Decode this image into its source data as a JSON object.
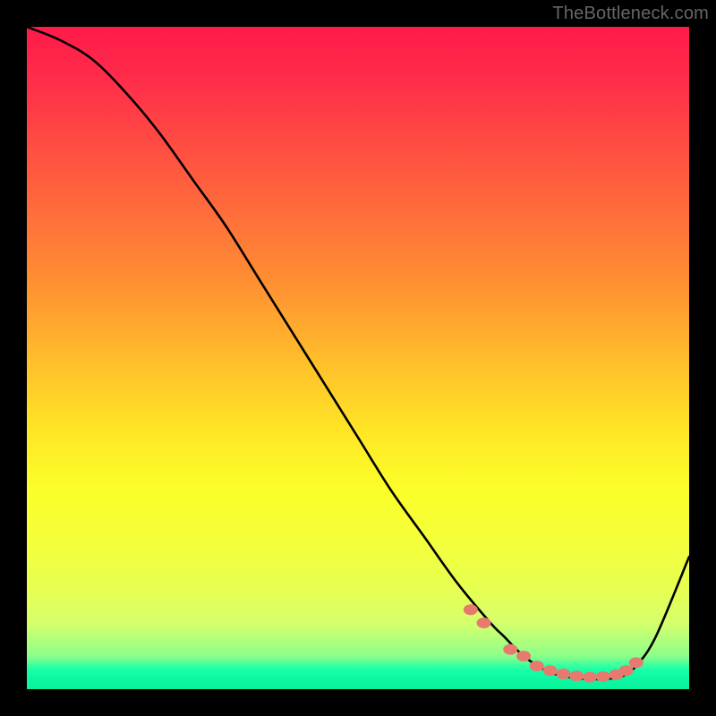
{
  "watermark": "TheBottleneck.com",
  "gradient_colors": {
    "top": "#ff1a4a",
    "mid_upper": "#ff8d33",
    "mid": "#ffe926",
    "mid_lower": "#e6ff52",
    "bottom": "#0af39c"
  },
  "curve_color": "#000000",
  "marker_color": "#e77a6f",
  "chart_data": {
    "type": "line",
    "title": "",
    "xlabel": "",
    "ylabel": "",
    "xlim": [
      0,
      100
    ],
    "ylim": [
      0,
      100
    ],
    "series": [
      {
        "name": "bottleneck-curve",
        "x": [
          0,
          5,
          10,
          15,
          20,
          25,
          30,
          35,
          40,
          45,
          50,
          55,
          60,
          65,
          70,
          72,
          75,
          78,
          80,
          82,
          85,
          88,
          90,
          92,
          95,
          100
        ],
        "y": [
          100,
          98,
          95,
          90,
          84,
          77,
          70,
          62,
          54,
          46,
          38,
          30,
          23,
          16,
          10,
          8,
          5,
          3,
          2.2,
          1.8,
          1.5,
          1.6,
          2,
          3.5,
          8,
          20
        ]
      }
    ],
    "markers": {
      "name": "highlighted-points",
      "x": [
        67,
        69,
        73,
        75,
        77,
        79,
        81,
        83,
        85,
        87,
        89,
        90.5,
        92
      ],
      "y": [
        12,
        10,
        6,
        5,
        3.5,
        2.8,
        2.3,
        2.0,
        1.8,
        1.9,
        2.2,
        2.8,
        4.0
      ]
    }
  }
}
